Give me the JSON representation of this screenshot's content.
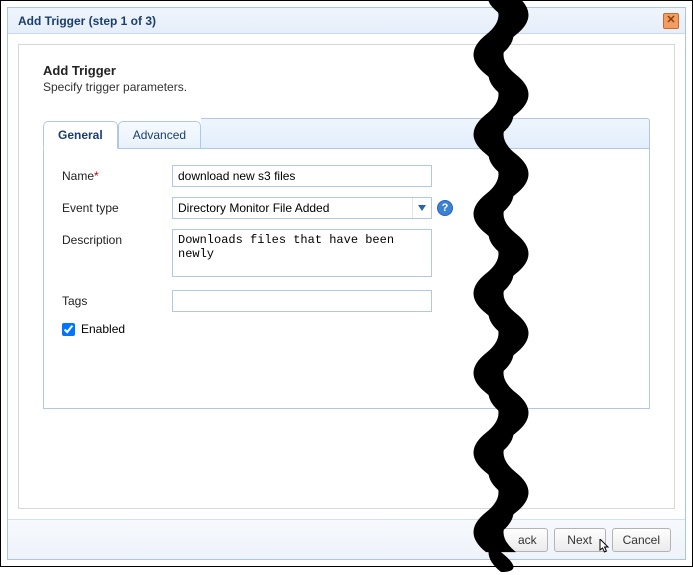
{
  "dialog": {
    "title": "Add Trigger (step 1 of 3)",
    "section_title": "Add Trigger",
    "section_subtitle": "Specify trigger parameters."
  },
  "tabs": {
    "general": "General",
    "advanced": "Advanced"
  },
  "form": {
    "name_label": "Name",
    "name_value": "download new s3 files",
    "event_type_label": "Event type",
    "event_type_value": "Directory Monitor File Added",
    "description_label": "Description",
    "description_value": "Downloads files that have been newly",
    "tags_label": "Tags",
    "tags_value": "",
    "enabled_label": "Enabled",
    "enabled_checked": true
  },
  "footer": {
    "back_partial": "ack",
    "next": "Next",
    "cancel": "Cancel"
  }
}
